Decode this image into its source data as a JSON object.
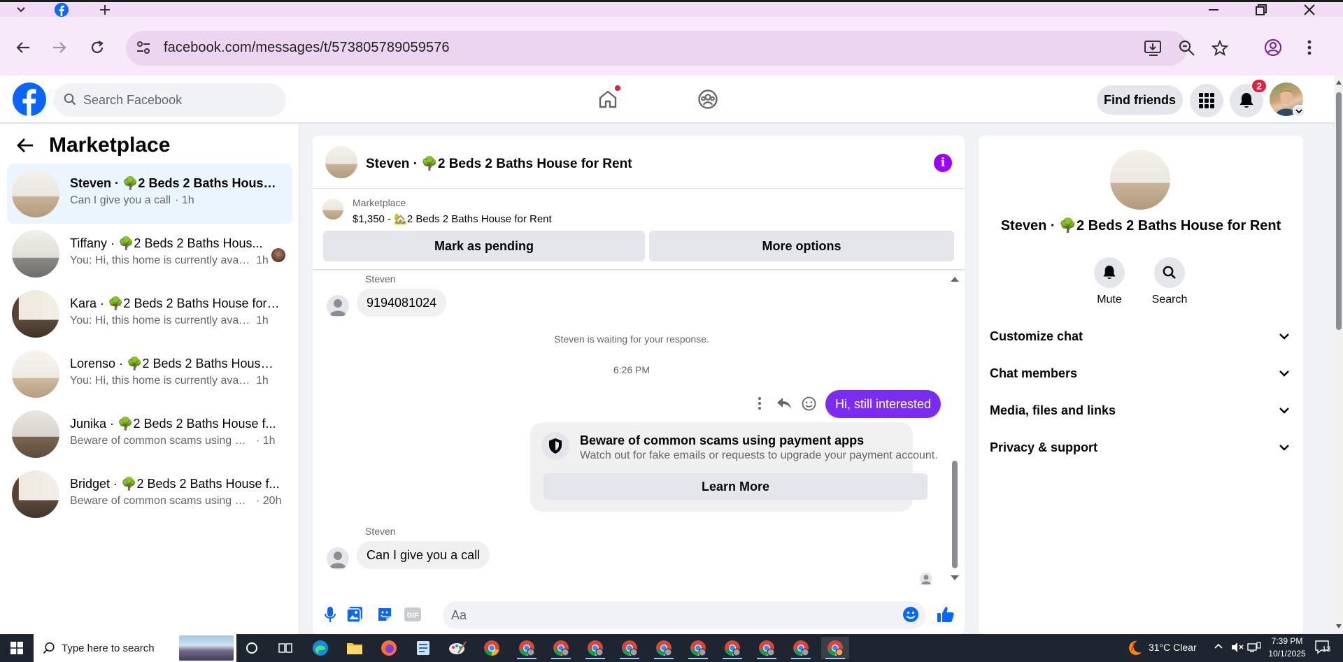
{
  "browser": {
    "url": "facebook.com/messages/t/573805789059576",
    "tab_icon": "facebook-icon"
  },
  "header": {
    "search_placeholder": "Search Facebook",
    "find_friends": "Find friends",
    "notification_count": "2"
  },
  "sidebar": {
    "title": "Marketplace",
    "conversations": [
      {
        "name": "Steven · 🌳2 Beds 2 Baths House f...",
        "preview": "Can I give you a call",
        "time": "· 1h"
      },
      {
        "name": "Tiffany · 🌳2 Beds 2 Baths Hous...",
        "preview": "You: Hi, this home is currently avail...",
        "time": "1h"
      },
      {
        "name": "Kara · 🌳2 Beds 2 Baths House for ...",
        "preview": "You: Hi, this home is currently availabl...",
        "time": "1h"
      },
      {
        "name": "Lorenso · 🌳2 Beds 2 Baths House ...",
        "preview": "You: Hi, this home is currently availabl...",
        "time": "1h"
      },
      {
        "name": "Junika · 🌳2 Beds 2 Baths House f...",
        "preview": "Beware of common scams using pay...",
        "time": "· 1h"
      },
      {
        "name": "Bridget · 🌳2 Beds 2 Baths House f...",
        "preview": "Beware of common scams using pay...",
        "time": "· 20h"
      }
    ]
  },
  "chat": {
    "title": "Steven · 🌳2 Beds 2 Baths House for Rent",
    "listing_category": "Marketplace",
    "listing_price": "$1,350 - 🏡2 Beds 2 Baths House for Rent",
    "mark_pending": "Mark as pending",
    "more_options": "More options",
    "messages": {
      "sender1": "Steven",
      "msg1": "9194081024",
      "waiting": "Steven is waiting for your response.",
      "timestamp": "6:26 PM",
      "outgoing": "Hi, still interested",
      "scam_title": "Beware of common scams using payment apps",
      "scam_sub": "Watch out for fake emails or requests to upgrade your payment account.",
      "learn_more": "Learn More",
      "sender2": "Steven",
      "msg2": "Can I give you a call"
    },
    "composer_placeholder": "Aa"
  },
  "details": {
    "title": "Steven · 🌳2 Beds 2 Baths House for Rent",
    "mute": "Mute",
    "search": "Search",
    "rows": [
      "Customize chat",
      "Chat members",
      "Media, files and links",
      "Privacy & support"
    ]
  },
  "taskbar": {
    "search_placeholder": "Type here to search",
    "weather": "31°C  Clear",
    "time": "7:39 PM",
    "date": "10/1/2025",
    "notifications": "13"
  },
  "colors": {
    "fb_blue": "#0866ff",
    "messenger_purple": "#7a2cf2",
    "info_purple": "#9b00ff",
    "active_conv": "#ebf5ff",
    "chrome_tab": "#f2dcf5"
  }
}
